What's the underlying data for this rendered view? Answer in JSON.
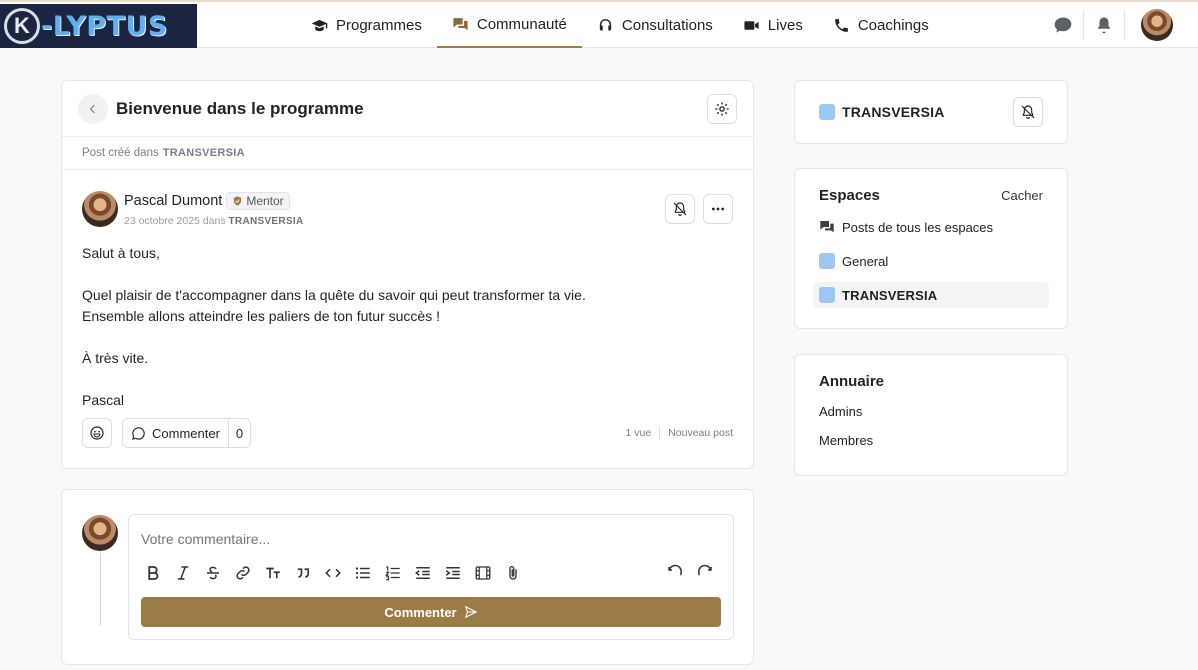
{
  "logo": {
    "mark": "K",
    "text": "-LYPTUS"
  },
  "nav": {
    "items": [
      {
        "label": "Programmes",
        "icon": "graduation-cap-icon"
      },
      {
        "label": "Communauté",
        "icon": "chat-bubbles-icon",
        "active": true
      },
      {
        "label": "Consultations",
        "icon": "headset-icon"
      },
      {
        "label": "Lives",
        "icon": "video-camera-icon"
      },
      {
        "label": "Coachings",
        "icon": "phone-icon"
      }
    ]
  },
  "post": {
    "title": "Bienvenue dans le programme",
    "created_prefix": "Post créé dans",
    "space": "TRANSVERSIA",
    "author": {
      "name": "Pascal Dumont",
      "badge": "Mentor",
      "date": "23 octobre 2025 dans",
      "space": "TRANSVERSIA"
    },
    "body": [
      "Salut à tous,",
      "Quel plaisir de t'accompagner dans la quête du savoir qui peut transformer ta vie.",
      "Ensemble allons atteindre les paliers de ton futur succès !",
      "À très vite.",
      "Pascal"
    ],
    "comment_label": "Commenter",
    "comment_count": "0",
    "views": "1 vue",
    "status": "Nouveau post"
  },
  "comment_form": {
    "placeholder": "Votre commentaire...",
    "submit_label": "Commenter"
  },
  "sidebar": {
    "current_space": "TRANSVERSIA",
    "spaces": {
      "title": "Espaces",
      "toggle": "Cacher",
      "items": [
        {
          "label": "Posts de tous les espaces"
        },
        {
          "label": "General"
        },
        {
          "label": "TRANSVERSIA",
          "active": true
        }
      ]
    },
    "directory": {
      "title": "Annuaire",
      "items": [
        "Admins",
        "Membres"
      ]
    }
  },
  "colors": {
    "accent": "#9b7b46",
    "space": "#9cc6f3",
    "logo_bg": "#1b2440"
  }
}
